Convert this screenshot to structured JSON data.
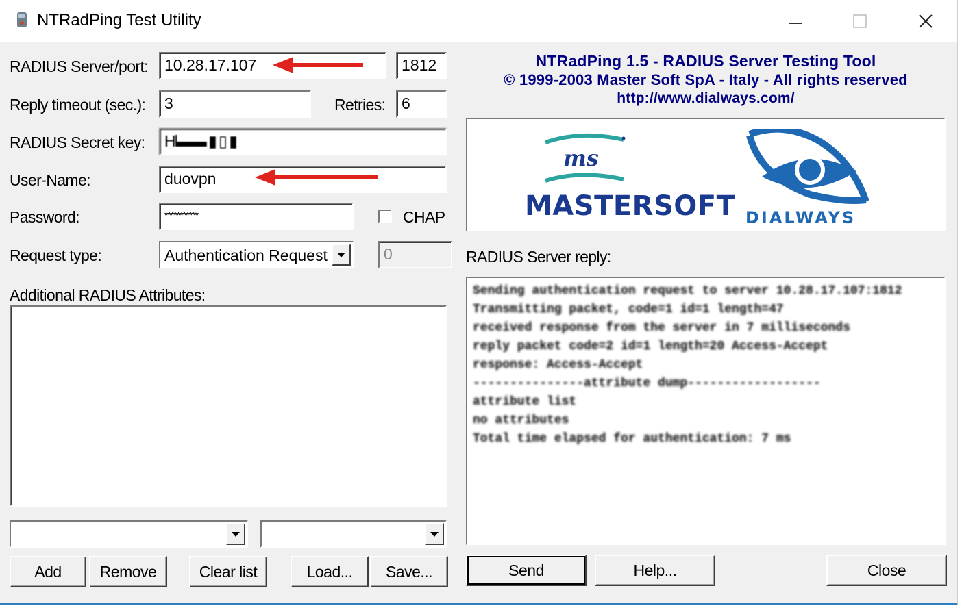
{
  "window": {
    "title": "NTRadPing Test Utility",
    "controls": [
      "minimize-icon",
      "maximize-icon",
      "close-icon"
    ]
  },
  "form": {
    "server_label": "RADIUS Server/port:",
    "server_value": "10.28.17.107",
    "port_value": "1812",
    "timeout_label": "Reply timeout (sec.):",
    "timeout_value": "3",
    "retries_label": "Retries:",
    "retries_value": "6",
    "secret_label": "RADIUS Secret key:",
    "secret_value": "Hl▬▬ ▮ ▯ ▮",
    "username_label": "User-Name:",
    "username_value": "duovpn",
    "password_label": "Password:",
    "password_value": "***********",
    "chap_label": "CHAP",
    "chap_checked": false,
    "request_type_label": "Request type:",
    "request_type_value": "Authentication Request",
    "request_id_value": "0",
    "attributes_label": "Additional RADIUS Attributes:"
  },
  "attribute_buttons": [
    "Add",
    "Remove",
    "Clear list",
    "Load...",
    "Save..."
  ],
  "banner": {
    "line1": "NTRadPing 1.5 - RADIUS Server Testing Tool",
    "line2": "© 1999-2003 Master Soft SpA - Italy - All rights reserved",
    "line3": "http://www.dialways.com/",
    "color": "#000080"
  },
  "logos": {
    "mastersoft_ms": "ms",
    "mastersoft_text": "MASTERSOFT",
    "dialways_text": "DIALWAYS",
    "mastersoft_color": "#1a3a8f",
    "accent_teal": "#2aa5a0",
    "dialways_color": "#1f68b3"
  },
  "reply": {
    "label": "RADIUS Server reply:",
    "lines": [
      "Sending authentication request to server 10.28.17.107:1812",
      "Transmitting packet, code=1 id=1 length=47",
      "received response from the server in 7 milliseconds",
      "reply packet code=2 id=1 length=20 Access-Accept",
      "response: Access-Accept",
      "---------------attribute dump------------------",
      "attribute list",
      "                 no attributes",
      "Total time elapsed for authentication: 7 ms"
    ]
  },
  "bottom_buttons": [
    "Send",
    "Help...",
    "Close"
  ],
  "annotation_color": "#e0231c"
}
